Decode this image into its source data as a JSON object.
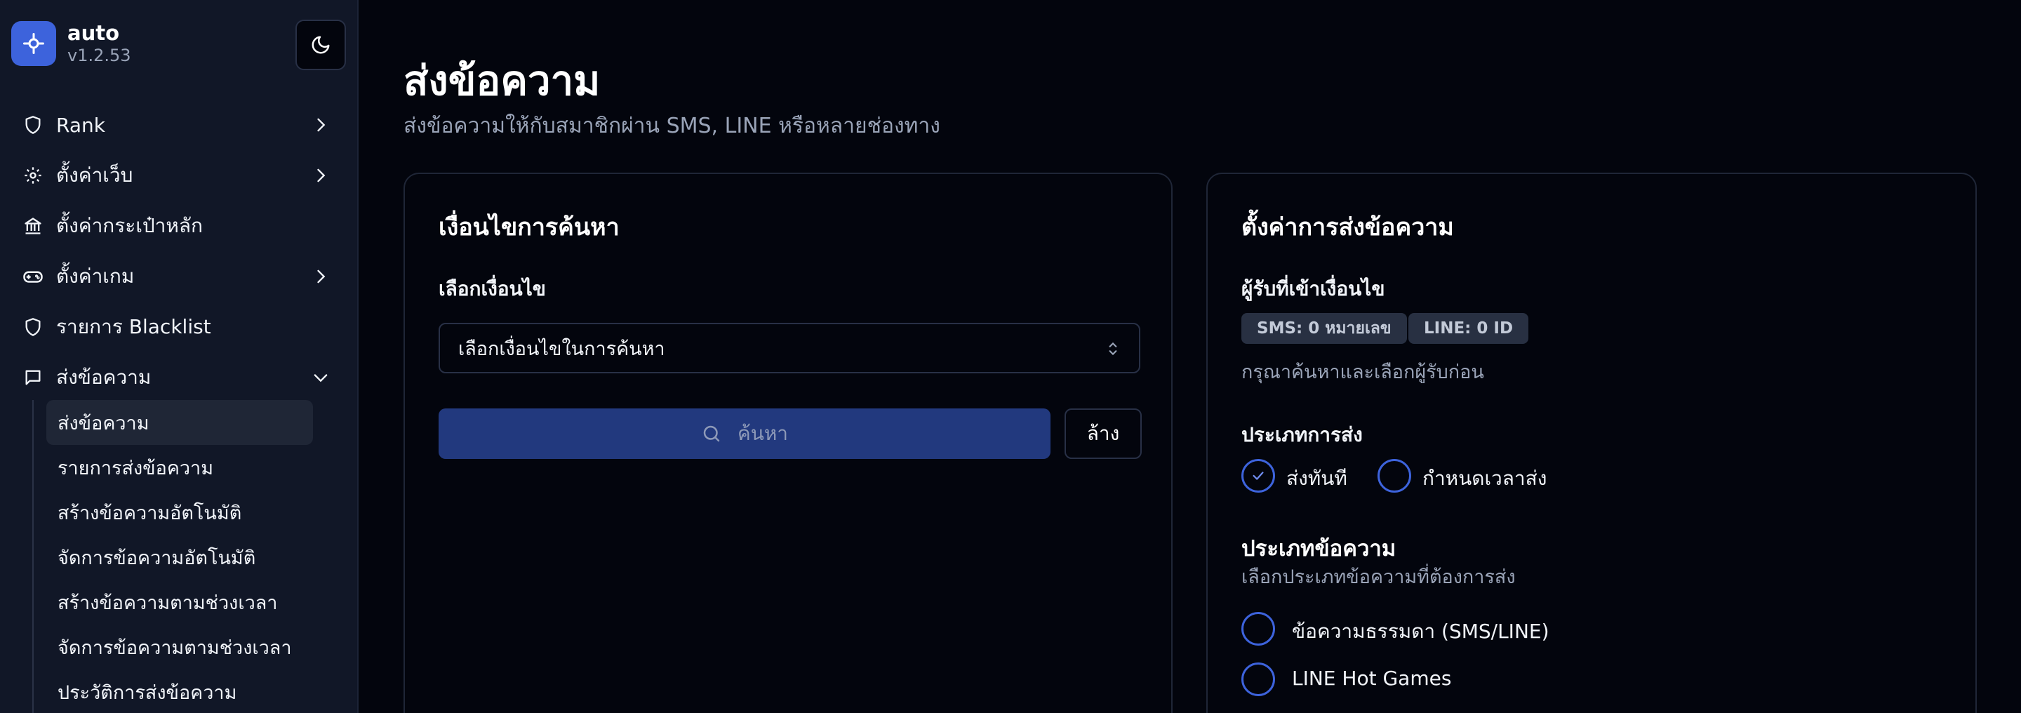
{
  "brand": {
    "name": "auto",
    "version": "v1.2.53"
  },
  "sidebar": {
    "items": [
      {
        "label": "Rank",
        "icon": "shield-icon",
        "chevron": "right"
      },
      {
        "label": "ตั้งค่าเว็บ",
        "icon": "gear-icon",
        "chevron": "right"
      },
      {
        "label": "ตั้งค่ากระเป๋าหลัก",
        "icon": "bank-icon",
        "chevron": ""
      },
      {
        "label": "ตั้งค่าเกม",
        "icon": "gamepad-icon",
        "chevron": "right"
      },
      {
        "label": "รายการ Blacklist",
        "icon": "shield-icon",
        "chevron": ""
      },
      {
        "label": "ส่งข้อความ",
        "icon": "message-icon",
        "chevron": "down"
      }
    ],
    "subitems": [
      {
        "label": "ส่งข้อความ",
        "active": true
      },
      {
        "label": "รายการส่งข้อความ",
        "active": false
      },
      {
        "label": "สร้างข้อความอัตโนมัติ",
        "active": false
      },
      {
        "label": "จัดการข้อความอัตโนมัติ",
        "active": false
      },
      {
        "label": "สร้างข้อความตามช่วงเวลา",
        "active": false
      },
      {
        "label": "จัดการข้อความตามช่วงเวลา",
        "active": false
      },
      {
        "label": "ประวัติการส่งข้อความ",
        "active": false
      }
    ]
  },
  "page": {
    "title": "ส่งข้อความ",
    "subtitle": "ส่งข้อความให้กับสมาชิกผ่าน SMS, LINE หรือหลายช่องทาง"
  },
  "search_card": {
    "title": "เงื่อนไขการค้นหา",
    "select_label": "เลือกเงื่อนไข",
    "select_value": "เลือกเงื่อนไขในการค้นหา",
    "search_button": "ค้นหา",
    "clear_button": "ล้าง"
  },
  "settings_card": {
    "title": "ตั้งค่าการส่งข้อความ",
    "recipients_label": "ผู้รับที่เข้าเงื่อนไข",
    "sms_badge": "SMS: 0 หมายเลข",
    "line_badge": "LINE: 0 ID",
    "recipients_hint": "กรุณาค้นหาและเลือกผู้รับก่อน",
    "send_type_label": "ประเภทการส่ง",
    "send_now": "ส่งทันที",
    "send_scheduled": "กำหนดเวลาส่ง",
    "send_type_selected": "ส่งทันที",
    "message_type_title": "ประเภทข้อความ",
    "message_type_desc": "เลือกประเภทข้อความที่ต้องการส่ง",
    "message_type_options": [
      "ข้อความธรรมดา (SMS/LINE)",
      "LINE Hot Games"
    ]
  },
  "colors": {
    "accent": "#3d63dc",
    "background": "#03050d",
    "sidebar": "#111727",
    "search_button": "#22397e"
  }
}
